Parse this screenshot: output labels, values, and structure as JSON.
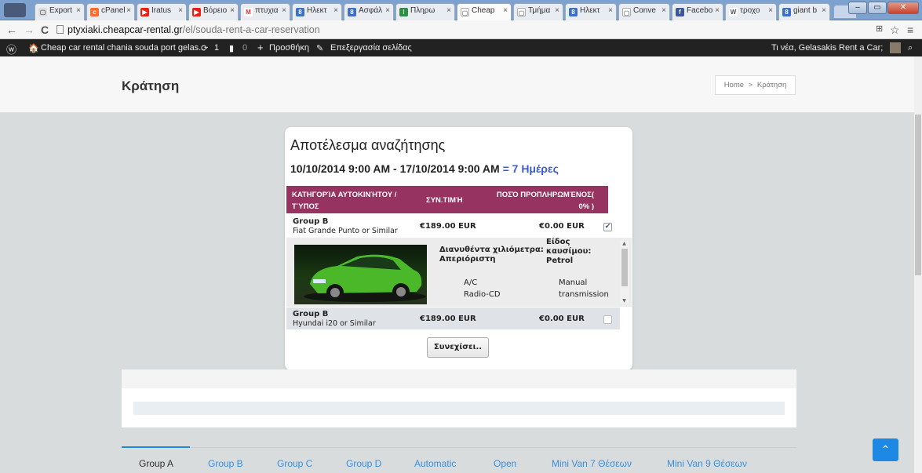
{
  "browser": {
    "tabs": [
      "Export",
      "cPanel",
      "Iratus",
      "Βόρειο",
      "πτυχια",
      "Ηλεκτ",
      "Ασφάλ",
      "Πληρω",
      "Cheap",
      "Τμήμα",
      "Ηλεκτ",
      "Conve",
      "Facebo",
      "τροχο",
      "giant b"
    ],
    "active_tab": "Cheap",
    "url_host": "ptyxiaki.cheapcar-rental.gr",
    "url_path": "/el/souda-rent-a-car-reservation"
  },
  "wp_admin_bar": {
    "site_name": "Cheap car rental chania souda port gelas...",
    "updates_count": "1",
    "comments_count": "0",
    "new_label": "Προσθήκη",
    "edit_label": "Επεξεργασία σελίδας",
    "greeting": "Τι νέα, Gelasakis Rent a Car;"
  },
  "page": {
    "title": "Κράτηση",
    "breadcrumb_home": "Home",
    "breadcrumb_sep": ">",
    "breadcrumb_current": "Κράτηση"
  },
  "result": {
    "heading": "Αποτέλεσμα αναζήτησης",
    "dates": "10/10/2014 9:00 AM - 17/10/2014 9:00 AM",
    "days": "= 7 Ημέρες",
    "columns": [
      "ΚΑΤΗΓΟΡΊΑ ΑΥΤΟΚΙΝΉΤΟΥ / ΤΎΠΟΣ",
      "ΣΥΝ.ΤΙΜΉ",
      "ΠΟΣΌ ΠΡΟΠΛΗΡΩΜΈΝΟΣ( 0% )"
    ],
    "cars": [
      {
        "group": "Group B",
        "model": "Fiat Grande Punto or Similar",
        "total": "€189.00 EUR",
        "prepaid": "€0.00 EUR",
        "checked": true
      },
      {
        "group": "Group B",
        "model": "Hyundai i20 or Similar",
        "total": "€189.00 EUR",
        "prepaid": "€0.00 EUR",
        "checked": false
      }
    ],
    "details": {
      "mileage_label": "Διανυθέντα χιλιόμετρα:",
      "mileage_value": "Απεριόριστη",
      "fuel_label": "Είδος καυσίμου:",
      "fuel_value": "Petrol",
      "feature_1": "A/C",
      "feature_2": "Radio-CD",
      "transmission_1": "Manual",
      "transmission_2": "transmission"
    },
    "continue_label": "Συνεχίσει.."
  },
  "group_tabs": [
    "Group A",
    "Group B",
    "Group C",
    "Group D",
    "Automatic",
    "Open",
    "Mini Van 7 Θέσεων",
    "Mini Van 9 Θέσεων"
  ],
  "colors": {
    "table_header": "#963361",
    "accent": "#3a8fdc",
    "days": "#3c5bd6"
  }
}
